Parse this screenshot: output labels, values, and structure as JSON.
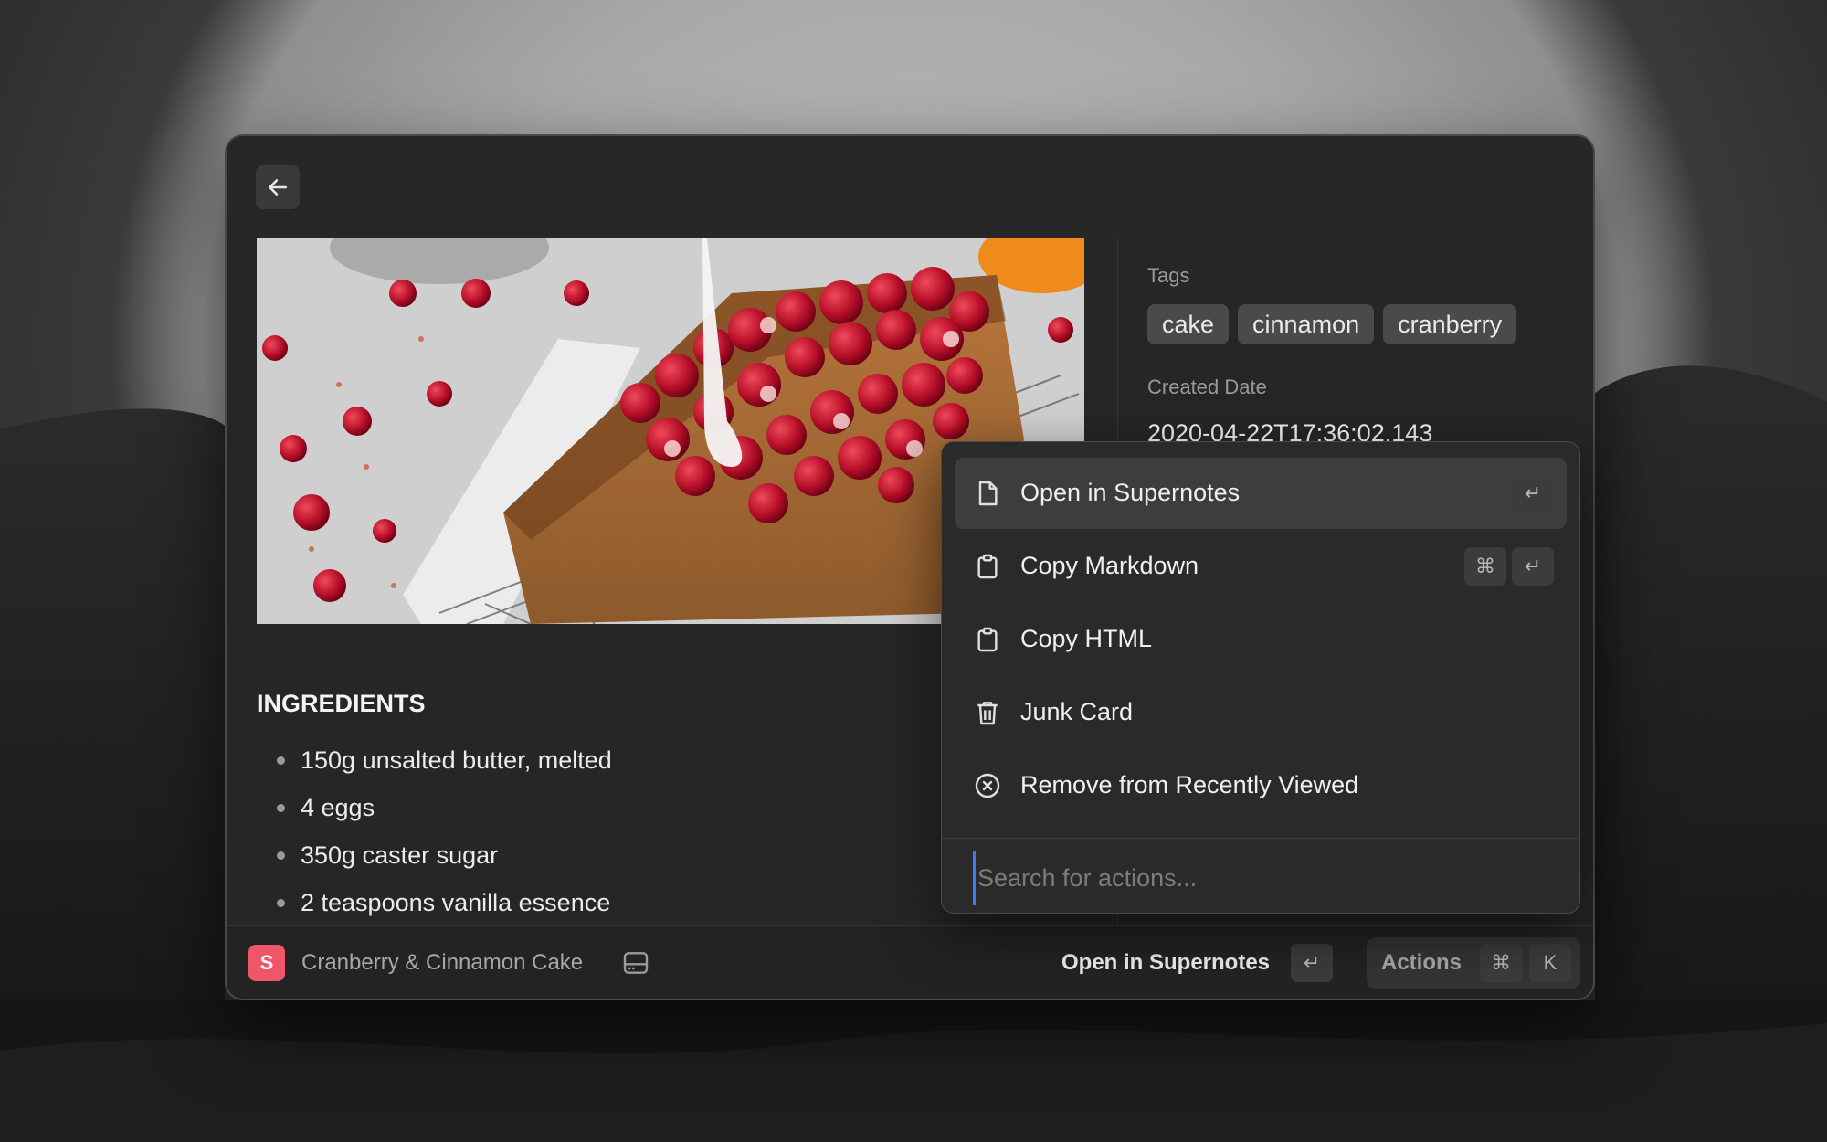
{
  "window": {
    "back_icon": "arrow-left-icon"
  },
  "note": {
    "image_alt": "Cranberry cake with glaze",
    "ingredients_title": "INGREDIENTS",
    "ingredients": [
      "150g unsalted butter, melted",
      "4 eggs",
      "350g caster sugar",
      "2 teaspoons vanilla essence"
    ]
  },
  "meta": {
    "tags_label": "Tags",
    "tags": [
      "cake",
      "cinnamon",
      "cranberry"
    ],
    "created_label": "Created Date",
    "created_value": "2020-04-22T17:36:02.143"
  },
  "actions_menu": {
    "items": [
      {
        "label": "Open in Supernotes",
        "icon": "document-icon",
        "shortcut": [
          "↵"
        ]
      },
      {
        "label": "Copy Markdown",
        "icon": "clipboard-icon",
        "shortcut": [
          "⌘",
          "↵"
        ]
      },
      {
        "label": "Copy HTML",
        "icon": "clipboard-icon",
        "shortcut": []
      },
      {
        "label": "Junk Card",
        "icon": "trash-icon",
        "shortcut": []
      },
      {
        "label": "Remove from Recently Viewed",
        "icon": "x-circle-icon",
        "shortcut": []
      }
    ],
    "search_placeholder": "Search for actions..."
  },
  "footer": {
    "app_icon_letter": "S",
    "title": "Cranberry & Cinnamon Cake",
    "primary_action": "Open in Supernotes",
    "primary_key": "↵",
    "actions_label": "Actions",
    "actions_keys": [
      "⌘",
      "K"
    ]
  },
  "colors": {
    "accent": "#3a7cff",
    "app_brand": "#f0566a"
  }
}
